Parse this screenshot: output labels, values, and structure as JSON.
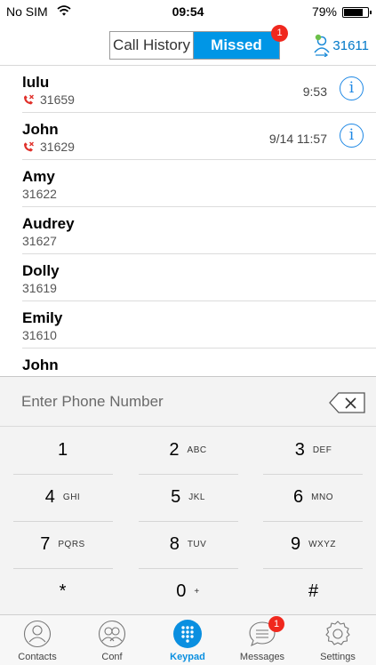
{
  "status_bar": {
    "carrier": "No SIM",
    "time": "09:54",
    "battery_percent_text": "79%",
    "battery_level": 0.79
  },
  "header": {
    "tabs": [
      {
        "label": "Call History"
      },
      {
        "label": "Missed"
      }
    ],
    "selected_tab": "Missed",
    "missed_badge": "1",
    "account_number": "31611",
    "accent_color": "#0096e6"
  },
  "calls": [
    {
      "name": "lulu",
      "number": "31659",
      "time": "9:53",
      "missed": true
    },
    {
      "name": "John",
      "number": "31629",
      "time": "9/14 11:57",
      "missed": true
    },
    {
      "name": "Amy",
      "number": "31622",
      "time": "",
      "missed": false
    },
    {
      "name": "Audrey",
      "number": "31627",
      "time": "",
      "missed": false
    },
    {
      "name": "Dolly",
      "number": "31619",
      "time": "",
      "missed": false
    },
    {
      "name": "Emily",
      "number": "31610",
      "time": "",
      "missed": false
    },
    {
      "name": "John",
      "number": "",
      "time": "",
      "missed": false
    }
  ],
  "keypad": {
    "placeholder": "Enter Phone Number",
    "keys": [
      {
        "digit": "1",
        "letters": ""
      },
      {
        "digit": "2",
        "letters": "ABC"
      },
      {
        "digit": "3",
        "letters": "DEF"
      },
      {
        "digit": "4",
        "letters": "GHI"
      },
      {
        "digit": "5",
        "letters": "JKL"
      },
      {
        "digit": "6",
        "letters": "MNO"
      },
      {
        "digit": "7",
        "letters": "PQRS"
      },
      {
        "digit": "8",
        "letters": "TUV"
      },
      {
        "digit": "9",
        "letters": "WXYZ"
      },
      {
        "digit": "*",
        "letters": ""
      },
      {
        "digit": "0",
        "letters": "+"
      },
      {
        "digit": "#",
        "letters": ""
      }
    ]
  },
  "tabbar": {
    "items": [
      {
        "label": "Contacts",
        "icon": "contacts-icon"
      },
      {
        "label": "Conf",
        "icon": "conference-icon"
      },
      {
        "label": "Keypad",
        "icon": "keypad-icon"
      },
      {
        "label": "Messages",
        "icon": "messages-icon",
        "badge": "1"
      },
      {
        "label": "Settings",
        "icon": "settings-icon"
      }
    ],
    "active": "Keypad"
  }
}
